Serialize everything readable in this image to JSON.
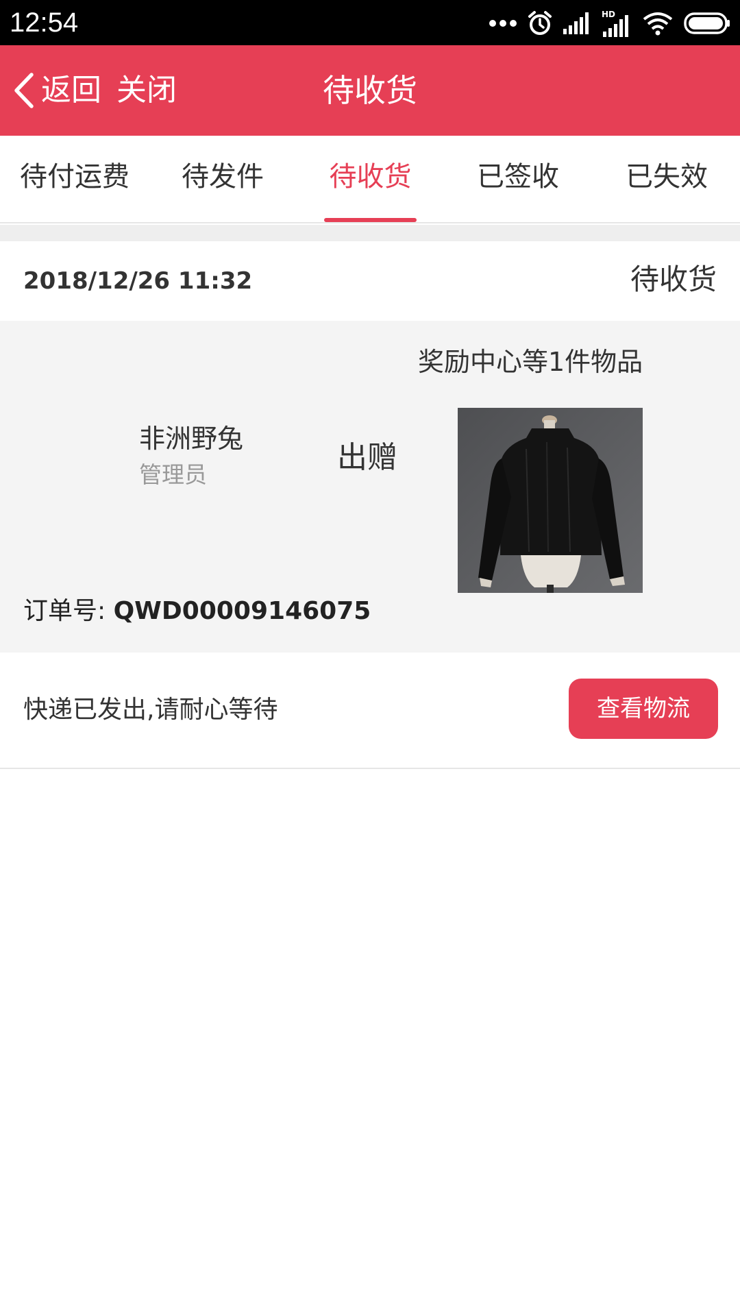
{
  "status_bar": {
    "time": "12:54",
    "icons": [
      "more-dots-icon",
      "alarm-icon",
      "signal-icon",
      "hd-signal-icon",
      "wifi-icon",
      "battery-icon"
    ],
    "hd_label": "HD"
  },
  "header": {
    "back_label": "返回",
    "close_label": "关闭",
    "title": "待收货",
    "background_color": "#e63f55"
  },
  "tabs": [
    {
      "label": "待付运费",
      "active": false
    },
    {
      "label": "待发件",
      "active": false
    },
    {
      "label": "待收货",
      "active": true
    },
    {
      "label": "已签收",
      "active": false
    },
    {
      "label": "已失效",
      "active": false
    }
  ],
  "order": {
    "date": "2018/12/26  11:32",
    "status": "待收货",
    "gift_description": "奖励中心等1件物品",
    "sender_name": "非洲野兔",
    "sender_role": "管理员",
    "action": "出赠",
    "product_image": "black-sweater-on-mannequin",
    "order_no_label": "订单号: ",
    "order_no": "QWD00009146075",
    "shipping_note": "快递已发出,请耐心等待",
    "logistics_button": "查看物流"
  },
  "colors": {
    "accent": "#e63f55",
    "card_background": "#f4f4f4",
    "secondary_text": "#999999"
  }
}
